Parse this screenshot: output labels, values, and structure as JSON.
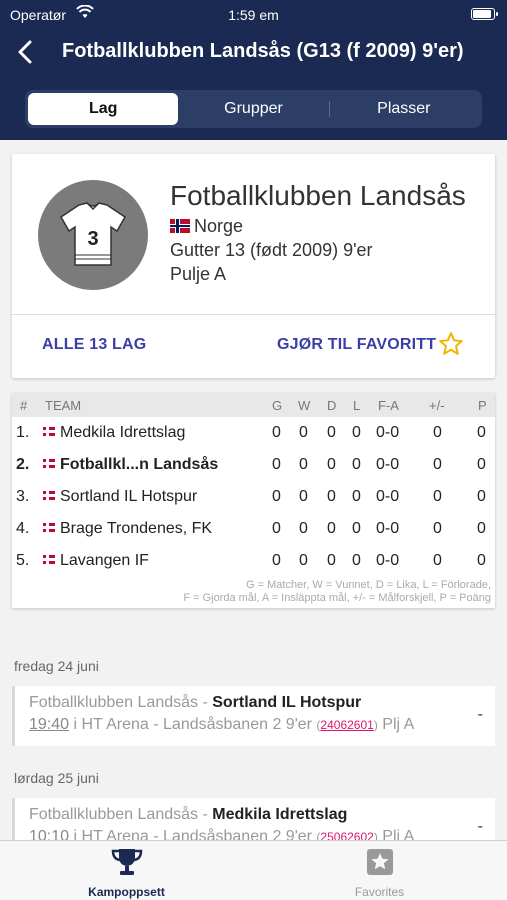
{
  "status": {
    "carrier": "Operatør",
    "time": "1:59 em"
  },
  "nav": {
    "title": "Fotballklubben Landsås (G13 (f 2009) 9'er)"
  },
  "segments": [
    {
      "label": "Lag",
      "active": true
    },
    {
      "label": "Grupper",
      "active": false
    },
    {
      "label": "Plasser",
      "active": false
    }
  ],
  "team": {
    "name": "Fotballklubben Landsås",
    "country": "Norge",
    "category": "Gutter 13 (født 2009) 9'er",
    "pool": "Pulje A",
    "jersey_number": "3",
    "all_teams_label": "ALLE 13 LAG",
    "favorite_label": "GJØR TIL FAVORITT"
  },
  "standings": {
    "headers": {
      "rank": "#",
      "team": "TEAM",
      "g": "G",
      "w": "W",
      "d": "D",
      "l": "L",
      "fa": "F-A",
      "diff": "+/-",
      "p": "P"
    },
    "rows": [
      {
        "rank": "1.",
        "team": "Medkila Idrettslag",
        "g": "0",
        "w": "0",
        "d": "0",
        "l": "0",
        "fa": "0-0",
        "diff": "0",
        "p": "0",
        "bold": false
      },
      {
        "rank": "2.",
        "team": "Fotballkl...n Landsås",
        "g": "0",
        "w": "0",
        "d": "0",
        "l": "0",
        "fa": "0-0",
        "diff": "0",
        "p": "0",
        "bold": true
      },
      {
        "rank": "3.",
        "team": "Sortland IL Hotspur",
        "g": "0",
        "w": "0",
        "d": "0",
        "l": "0",
        "fa": "0-0",
        "diff": "0",
        "p": "0",
        "bold": false
      },
      {
        "rank": "4.",
        "team": "Brage Trondenes, FK",
        "g": "0",
        "w": "0",
        "d": "0",
        "l": "0",
        "fa": "0-0",
        "diff": "0",
        "p": "0",
        "bold": false
      },
      {
        "rank": "5.",
        "team": "Lavangen IF",
        "g": "0",
        "w": "0",
        "d": "0",
        "l": "0",
        "fa": "0-0",
        "diff": "0",
        "p": "0",
        "bold": false
      }
    ],
    "legend1": "G = Matcher, W = Vunnet, D = Lika, L = Förlorade,",
    "legend2": "F = Gjorda mål, A = Insläppta mål, +/- = Målforskjell, P = Poäng"
  },
  "matches": [
    {
      "date": "fredag 24 juni",
      "home": "Fotballklubben Landsås",
      "away": "Sortland IL Hotspur",
      "time": "19:40",
      "venue": "i HT Arena - Landsåsbanen 2 9'er",
      "id": "24062601",
      "pool": "Plj A",
      "score": "-"
    },
    {
      "date": "lørdag 25 juni",
      "home": "Fotballklubben Landsås",
      "away": "Medkila Idrettslag",
      "time": "10:10",
      "venue": "i HT Arena - Landsåsbanen 2 9'er",
      "id": "25062602",
      "pool": "Plj A",
      "score": "-"
    }
  ],
  "tabs": [
    {
      "label": "Kampoppsett",
      "icon": "trophy-icon",
      "active": true
    },
    {
      "label": "Favorites",
      "icon": "star-icon",
      "active": false
    }
  ],
  "colors": {
    "header": "#1b2a52",
    "accent": "#3a3fa8",
    "star": "#f0b400",
    "match_id": "#e0146e"
  }
}
